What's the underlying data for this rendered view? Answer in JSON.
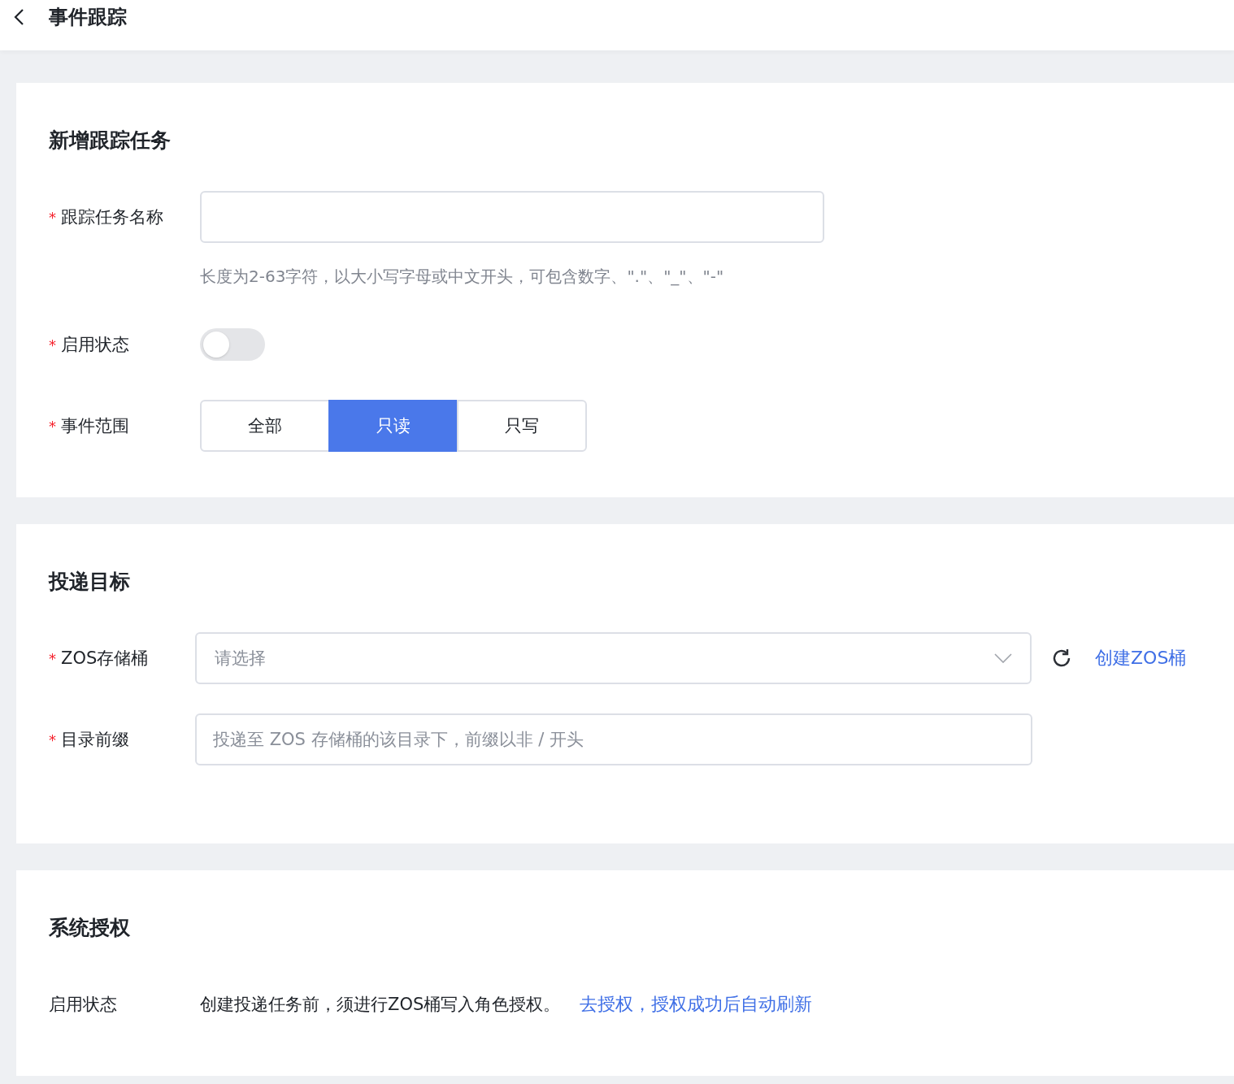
{
  "header": {
    "title": "事件跟踪"
  },
  "required_symbol": "*",
  "sections": [
    {
      "title": "新增跟踪任务",
      "fields": [
        {
          "kind": "input",
          "label": "跟踪任务名称",
          "required": true,
          "hint": "长度为2-63字符，以大小写字母或中文开头，可包含数字、\".\"、\"_\"、\"-\""
        },
        {
          "kind": "switch",
          "label": "启用状态",
          "required": true,
          "on": false
        },
        {
          "kind": "segmented",
          "label": "事件范围",
          "required": true,
          "options": [
            {
              "label": "全部",
              "selected": false
            },
            {
              "label": "只读",
              "selected": true
            },
            {
              "label": "只写",
              "selected": false
            }
          ]
        }
      ]
    },
    {
      "title": "投递目标",
      "fields": [
        {
          "kind": "select",
          "label": "ZOS存储桶",
          "required": true,
          "placeholder": "请选择",
          "link": "创建ZOS桶"
        },
        {
          "kind": "input",
          "label": "目录前缀",
          "required": true,
          "placeholder": "投递至 ZOS 存储桶的该目录下，前缀以非 / 开头"
        }
      ]
    },
    {
      "title": "系统授权",
      "fields": [
        {
          "kind": "info",
          "label": "启用状态",
          "required": false,
          "text": "创建投递任务前，须进行ZOS桶写入角色授权。",
          "link": "去授权，授权成功后自动刷新"
        }
      ]
    }
  ]
}
